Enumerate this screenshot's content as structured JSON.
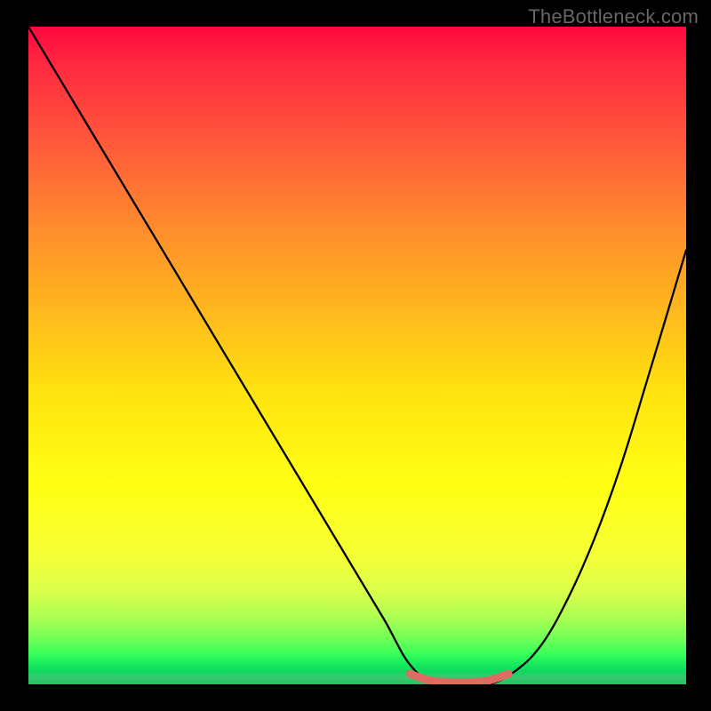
{
  "watermark": "TheBottleneck.com",
  "chart_data": {
    "type": "line",
    "title": "",
    "xlabel": "",
    "ylabel": "",
    "xlim": [
      0,
      100
    ],
    "ylim": [
      0,
      100
    ],
    "grid": false,
    "legend_position": "none",
    "series": [
      {
        "name": "bottleneck-curve",
        "color": "#000000",
        "x": [
          0,
          6,
          12,
          18,
          24,
          30,
          36,
          42,
          48,
          54,
          58,
          62,
          66,
          70,
          74,
          78,
          82,
          86,
          90,
          94,
          100
        ],
        "values": [
          100,
          90,
          80,
          70,
          60,
          50,
          40,
          30,
          20,
          10,
          3,
          0,
          0,
          0,
          2,
          6,
          13,
          22,
          33,
          46,
          66
        ]
      },
      {
        "name": "optimal-range-marker",
        "color": "#e06a60",
        "x": [
          58,
          61,
          64,
          67,
          70,
          73
        ],
        "values": [
          1.6,
          0.6,
          0.3,
          0.3,
          0.6,
          1.6
        ]
      }
    ],
    "background_gradient": {
      "top": "#ff0740",
      "mid": "#ffe40f",
      "bottom": "#1fc060"
    }
  }
}
